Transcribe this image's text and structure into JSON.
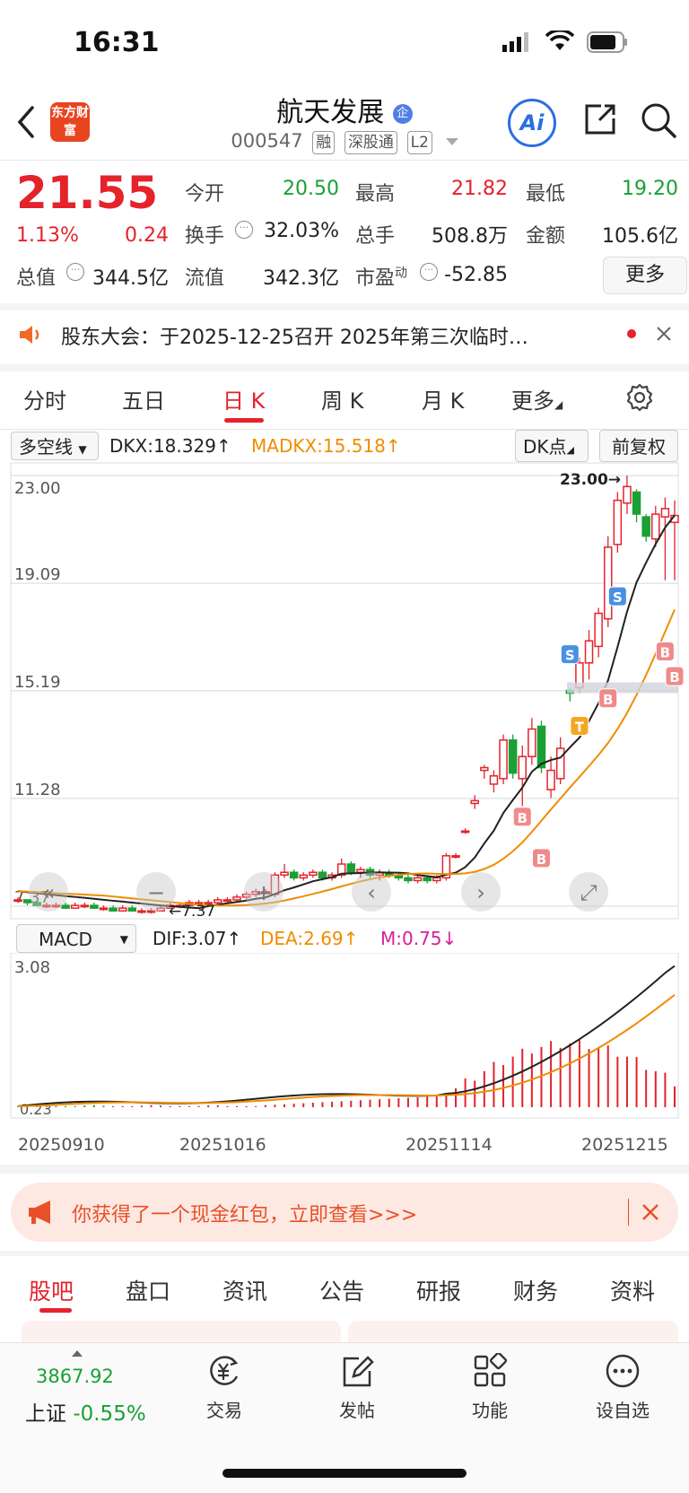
{
  "status": {
    "time": "16:31"
  },
  "header": {
    "logo_text": "东方财富",
    "title": "航天发展",
    "code": "000547",
    "tags": [
      "融",
      "深股通",
      "L2"
    ],
    "ai_label": "Ai",
    "colors": {
      "brand": "#e8441f",
      "accent_blue": "#2b6fe0"
    }
  },
  "quote": {
    "price": "21.55",
    "change_pct": "1.13%",
    "change": "0.24",
    "fields": [
      {
        "label": "今开",
        "value": "20.50",
        "color": "green"
      },
      {
        "label": "最高",
        "value": "21.82",
        "color": "red"
      },
      {
        "label": "最低",
        "value": "19.20",
        "color": "green"
      },
      {
        "label": "换手",
        "value": "32.03%"
      },
      {
        "label": "总手",
        "value": "508.8万"
      },
      {
        "label": "金额",
        "value": "105.6亿"
      },
      {
        "label": "总值",
        "value": "344.5亿"
      },
      {
        "label": "流值",
        "value": "342.3亿"
      },
      {
        "label": "市盈",
        "superscript": "动",
        "value": "-52.85"
      }
    ],
    "more_label": "更多"
  },
  "notice": {
    "text": "股东大会：于2025-12-25召开 2025年第三次临时…"
  },
  "kline_tabs": {
    "items": [
      "分时",
      "五日",
      "日 K",
      "周 K",
      "月 K",
      "更多"
    ],
    "active": "日 K"
  },
  "indicators": {
    "main_select": "多空线",
    "dkx": "DKX:18.329",
    "madkx": "MADKX:15.518",
    "dk_point": "DK点",
    "adjust": "前复权",
    "macd_select": "MACD",
    "dif": "DIF:3.07",
    "dea": "DEA:2.69",
    "m": "M:0.75"
  },
  "chart_data": [
    {
      "type": "candlestick",
      "title": "",
      "y_ticks": [
        "23.00",
        "19.09",
        "15.19",
        "11.28",
        "7.37"
      ],
      "ylim": [
        7.37,
        23.0
      ],
      "high_label": "23.00",
      "low_label": "7.37",
      "series": [
        {
          "name": "DKX",
          "color": "#222222",
          "last": 18.329
        },
        {
          "name": "MADKX",
          "color": "#f08c00",
          "last": 15.518
        }
      ],
      "candles": [
        [
          7.6,
          7.7,
          7.5,
          7.6
        ],
        [
          7.6,
          7.6,
          7.4,
          7.5
        ],
        [
          7.5,
          7.6,
          7.4,
          7.4
        ],
        [
          7.4,
          7.5,
          7.3,
          7.4
        ],
        [
          7.4,
          7.5,
          7.3,
          7.4
        ],
        [
          7.4,
          7.5,
          7.3,
          7.3
        ],
        [
          7.3,
          7.5,
          7.3,
          7.4
        ],
        [
          7.4,
          7.5,
          7.3,
          7.4
        ],
        [
          7.4,
          7.5,
          7.3,
          7.3
        ],
        [
          7.3,
          7.4,
          7.2,
          7.3
        ],
        [
          7.3,
          7.4,
          7.2,
          7.2
        ],
        [
          7.2,
          7.4,
          7.2,
          7.3
        ],
        [
          7.3,
          7.4,
          7.2,
          7.2
        ],
        [
          7.2,
          7.3,
          7.1,
          7.2
        ],
        [
          7.2,
          7.3,
          7.1,
          7.2
        ],
        [
          7.2,
          7.4,
          7.2,
          7.3
        ],
        [
          7.3,
          7.5,
          7.3,
          7.4
        ],
        [
          7.4,
          7.5,
          7.3,
          7.4
        ],
        [
          7.4,
          7.6,
          7.4,
          7.5
        ],
        [
          7.5,
          7.6,
          7.4,
          7.5
        ],
        [
          7.5,
          7.6,
          7.4,
          7.5
        ],
        [
          7.5,
          7.7,
          7.4,
          7.6
        ],
        [
          7.6,
          7.7,
          7.5,
          7.6
        ],
        [
          7.6,
          7.8,
          7.5,
          7.7
        ],
        [
          7.7,
          7.9,
          7.6,
          7.8
        ],
        [
          7.8,
          8.0,
          7.7,
          7.9
        ],
        [
          7.9,
          8.0,
          7.8,
          7.9
        ],
        [
          7.8,
          8.6,
          7.7,
          8.5
        ],
        [
          8.5,
          8.9,
          8.4,
          8.6
        ],
        [
          8.6,
          8.7,
          8.3,
          8.4
        ],
        [
          8.4,
          8.6,
          8.3,
          8.5
        ],
        [
          8.5,
          8.7,
          8.4,
          8.6
        ],
        [
          8.6,
          8.7,
          8.3,
          8.4
        ],
        [
          8.4,
          8.6,
          8.3,
          8.5
        ],
        [
          8.5,
          9.1,
          8.4,
          8.9
        ],
        [
          8.9,
          9.0,
          8.5,
          8.6
        ],
        [
          8.6,
          8.8,
          8.4,
          8.7
        ],
        [
          8.7,
          8.8,
          8.4,
          8.5
        ],
        [
          8.5,
          8.7,
          8.3,
          8.6
        ],
        [
          8.6,
          8.7,
          8.4,
          8.5
        ],
        [
          8.5,
          8.6,
          8.3,
          8.4
        ],
        [
          8.4,
          8.5,
          8.2,
          8.3
        ],
        [
          8.3,
          8.5,
          8.2,
          8.4
        ],
        [
          8.4,
          8.5,
          8.2,
          8.3
        ],
        [
          8.3,
          8.5,
          8.2,
          8.4
        ],
        [
          8.4,
          9.3,
          8.3,
          9.2
        ],
        [
          9.2,
          9.3,
          9.1,
          9.2
        ],
        [
          10.1,
          10.2,
          10.0,
          10.1
        ],
        [
          11.1,
          11.4,
          10.9,
          11.2
        ],
        [
          12.3,
          12.5,
          12.0,
          12.4
        ],
        [
          11.8,
          12.3,
          11.5,
          12.1
        ],
        [
          12.0,
          13.6,
          11.8,
          13.4
        ],
        [
          13.4,
          13.6,
          12.0,
          12.2
        ],
        [
          12.0,
          13.2,
          11.0,
          12.8
        ],
        [
          12.8,
          14.2,
          12.5,
          13.8
        ],
        [
          13.9,
          14.1,
          12.2,
          12.4
        ],
        [
          11.6,
          12.8,
          11.3,
          12.3
        ],
        [
          12.0,
          13.5,
          11.8,
          13.1
        ],
        [
          15.2,
          15.3,
          14.8,
          15.1
        ],
        [
          15.3,
          16.4,
          15.1,
          16.2
        ],
        [
          16.2,
          17.4,
          15.6,
          17.0
        ],
        [
          16.8,
          18.2,
          16.4,
          18.0
        ],
        [
          17.8,
          20.8,
          17.5,
          20.4
        ],
        [
          20.5,
          22.4,
          20.2,
          22.1
        ],
        [
          22.0,
          23.0,
          21.6,
          22.6
        ],
        [
          22.4,
          22.5,
          21.3,
          21.6
        ],
        [
          21.5,
          21.6,
          20.6,
          20.8
        ],
        [
          20.7,
          21.9,
          20.4,
          21.6
        ],
        [
          21.5,
          22.2,
          19.2,
          21.8
        ],
        [
          21.3,
          22.1,
          19.2,
          21.55
        ]
      ],
      "signals": [
        "S",
        "S",
        "B",
        "B",
        "B",
        "B",
        "B",
        "T"
      ]
    },
    {
      "type": "bar",
      "title": "MACD",
      "y_ticks": [
        "3.08",
        "0.23"
      ],
      "x_ticks": [
        "20250910",
        "20251016",
        "20251114",
        "20251215"
      ],
      "series": [
        {
          "name": "DIF",
          "color": "#222222",
          "last": 3.07
        },
        {
          "name": "DEA",
          "color": "#f08c00",
          "last": 2.69
        },
        {
          "name": "M",
          "color": "#d81e9a",
          "last": 0.75
        }
      ]
    }
  ],
  "banner": {
    "text": "你获得了一个现金红包，立即查看>>>"
  },
  "bottom_tabs": {
    "items": [
      "股吧",
      "盘口",
      "资讯",
      "公告",
      "研报",
      "财务",
      "资料"
    ],
    "active": "股吧"
  },
  "bottom_nav": {
    "index_value": "3867.92",
    "index_name": "上证",
    "index_change": "-0.55%",
    "items": [
      "交易",
      "发帖",
      "功能",
      "设自选"
    ]
  }
}
